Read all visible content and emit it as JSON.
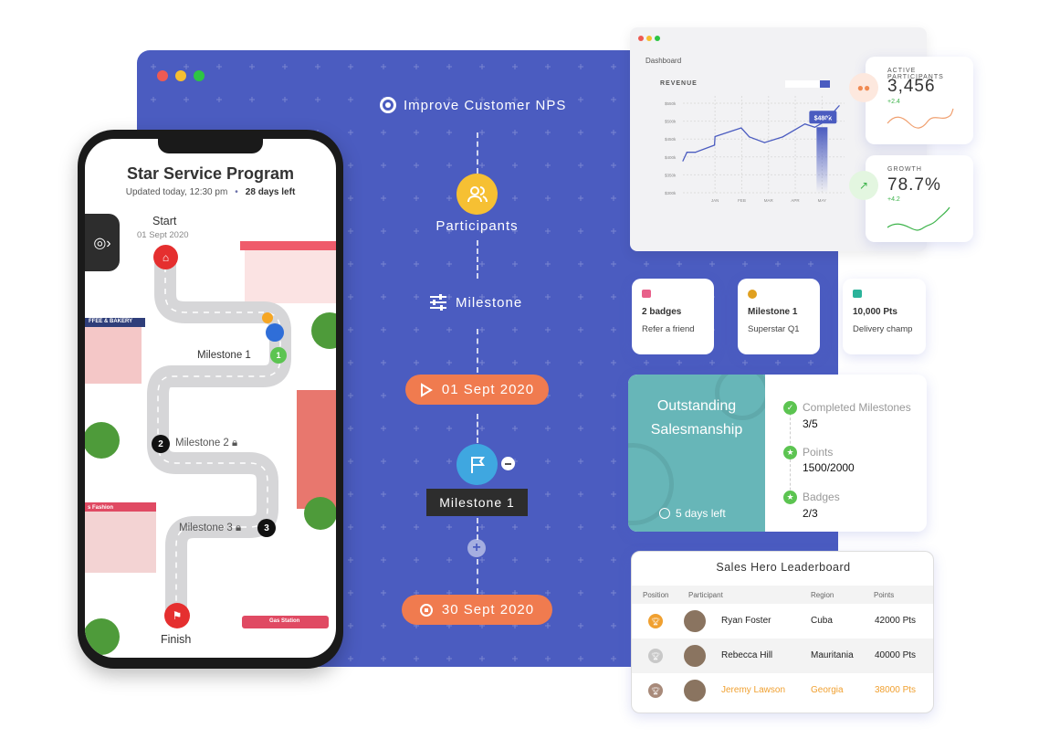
{
  "window_controls": {
    "colors": [
      "#ee5a52",
      "#f6be30",
      "#2dc543"
    ]
  },
  "timeline": {
    "goal": "Improve Customer NPS",
    "participants_label": "Participants",
    "milestone_label": "Milestone",
    "start_date": "01 Sept 2020",
    "milestone_tag": "Milestone 1",
    "end_date": "30 Sept 2020",
    "accent": "#f07b4f",
    "panel_color": "#4b5cc0"
  },
  "dashboard": {
    "title": "Dashboard",
    "chart_data": {
      "type": "line",
      "title": "REVENUE",
      "categories": [
        "JAN",
        "FEB",
        "MAR",
        "APR",
        "MAY"
      ],
      "y_ticks": [
        "$300k",
        "$350k",
        "$400k",
        "$450k",
        "$500k",
        "$550k"
      ],
      "ylim": [
        300,
        550
      ],
      "points": [
        [
          -0.2,
          389
        ],
        [
          -0.05,
          413
        ],
        [
          0.27,
          413
        ],
        [
          0.98,
          433
        ],
        [
          1.0,
          457
        ],
        [
          1.98,
          481
        ],
        [
          2.28,
          456
        ],
        [
          2.85,
          440
        ],
        [
          3.53,
          456
        ],
        [
          4.36,
          492
        ],
        [
          4.73,
          483
        ],
        [
          5.13,
          500
        ],
        [
          5.64,
          543
        ]
      ],
      "highlight": {
        "category": "MAY",
        "label": "$480k"
      },
      "grid": true,
      "color": "#4b5cc0"
    }
  },
  "stats": [
    {
      "label": "ACTIVE PARTICIPANTS",
      "value": "3,456",
      "delta": "+2.4",
      "icon": "users-icon",
      "color": "#f08a52"
    },
    {
      "label": "GROWTH",
      "value": "78.7%",
      "delta": "+4.2",
      "icon": "trending-up-icon",
      "color": "#3cb34a"
    }
  ],
  "badges": [
    {
      "title": "2 badges",
      "subtitle": "Refer a friend",
      "icon": "gift-icon",
      "color": "#e8608a"
    },
    {
      "title": "Milestone 1",
      "subtitle": "Superstar Q1",
      "icon": "medal-icon",
      "color": "#e0a020"
    },
    {
      "title": "10,000 Pts",
      "subtitle": "Delivery champ",
      "icon": "gift-icon",
      "color": "#2bb39a"
    }
  ],
  "challenge": {
    "title_line1": "Outstanding",
    "title_line2": "Salesmanship",
    "time_left": "5 days left",
    "items": [
      {
        "label": "Completed Milestones",
        "value": "3/5",
        "icon": "check-icon"
      },
      {
        "label": "Points",
        "value": "1500/2000",
        "icon": "star-icon"
      },
      {
        "label": "Badges",
        "value": "2/3",
        "icon": "ribbon-icon"
      }
    ]
  },
  "leaderboard": {
    "title": "Sales Hero Leaderboard",
    "columns": [
      "Position",
      "Participant",
      "Region",
      "Points"
    ],
    "rows": [
      {
        "name": "Ryan Foster",
        "region": "Cuba",
        "points": "42000 Pts",
        "trophy": "#f0a030"
      },
      {
        "name": "Rebecca Hill",
        "region": "Mauritania",
        "points": "40000 Pts",
        "trophy": "#c8c8c8"
      },
      {
        "name": "Jeremy Lawson",
        "region": "Georgia",
        "points": "38000 Pts",
        "trophy": "#a88a7a"
      }
    ]
  },
  "phone": {
    "title": "Star Service Program",
    "updated": "Updated today, 12:30 pm",
    "days_left": "28 days left",
    "start_label": "Start",
    "start_date": "01 Sept 2020",
    "milestones": [
      "Milestone 1",
      "Milestone 2",
      "Milestone 3"
    ],
    "finish_label": "Finish",
    "shops": [
      "FFEE & BAKERY",
      "s Fashion",
      "Gas Station"
    ]
  }
}
